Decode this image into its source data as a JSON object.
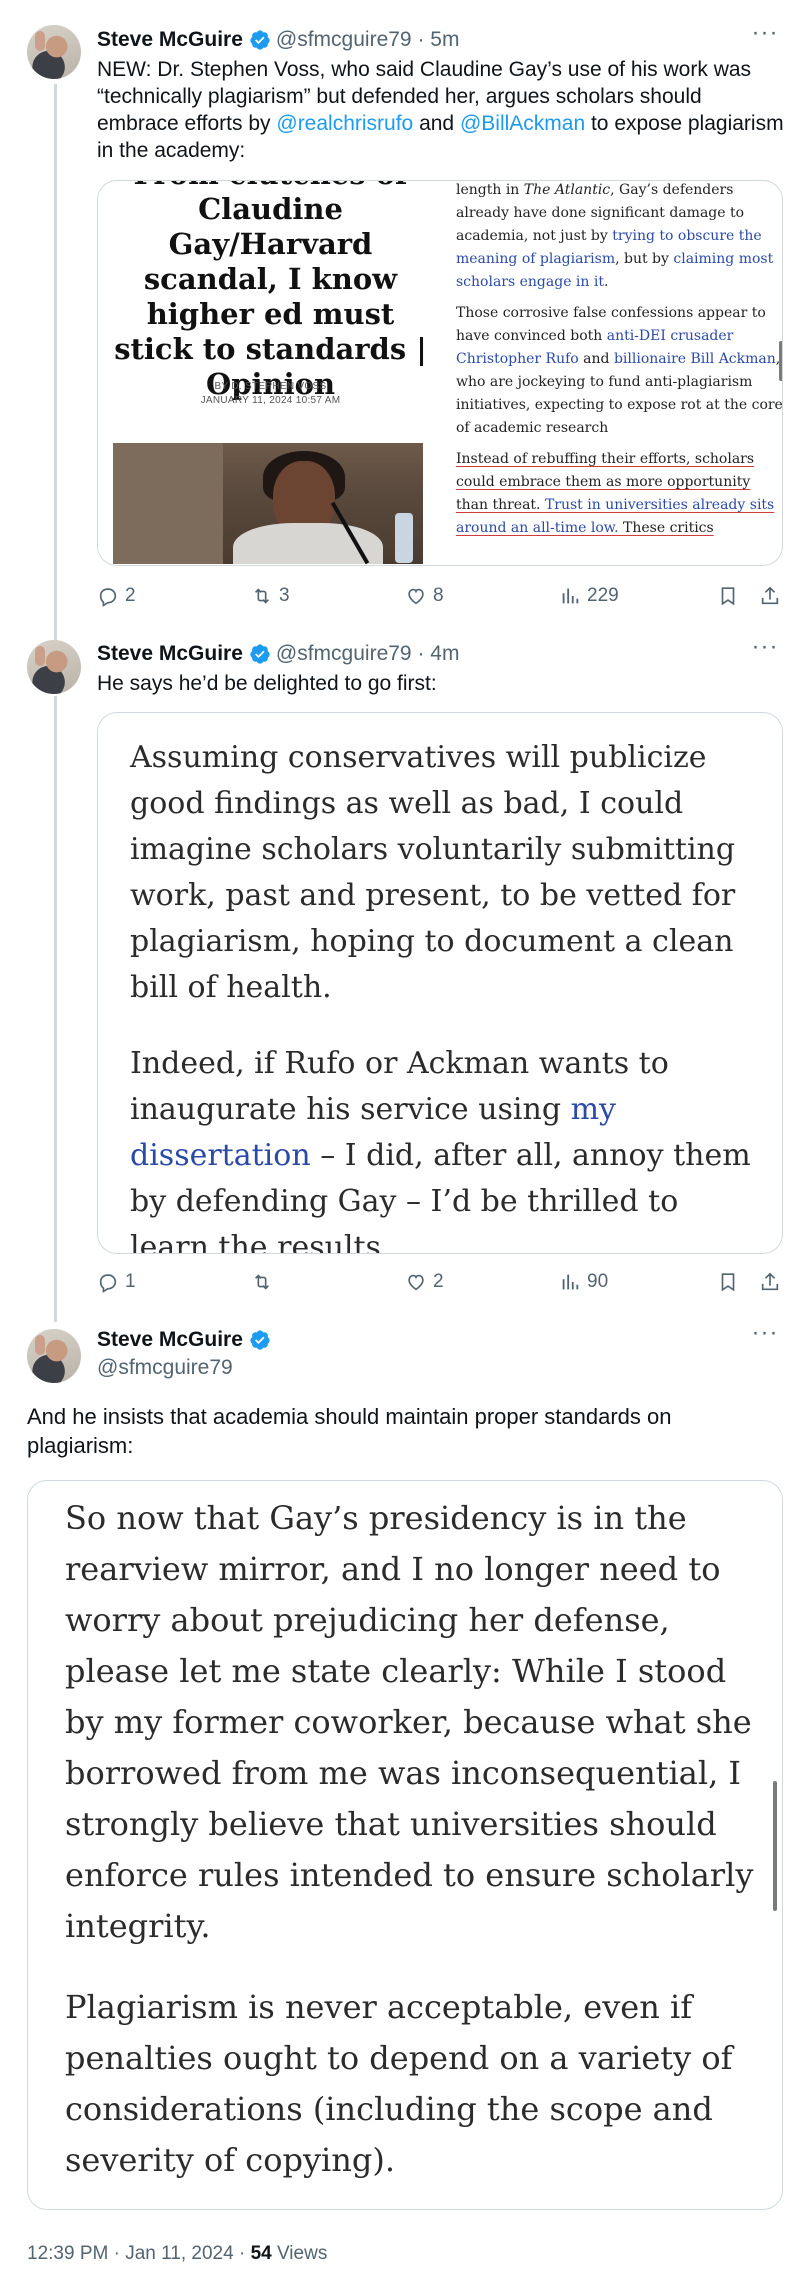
{
  "tweets": [
    {
      "name": "Steve McGuire",
      "handle": "@sfmcguire79",
      "time": "5m",
      "text_before": "NEW: Dr. Stephen Voss, who said Claudine Gay’s use of his work was “technically plagiarism” but defended her, argues scholars should embrace efforts by ",
      "mention1": "@realchrisrufo",
      "text_and": " and ",
      "mention2": "@BillAckman",
      "text_after": " to expose plagiarism in the academy:",
      "media": {
        "headline": "From clutches of Claudine Gay/Harvard scandal, I know higher ed must stick to standards | Opinion",
        "headline_visible": "Claudine Gay/Harvard scandal, I know higher ed must stick to standards | Opinion",
        "headline_cut_top": "From clutches of",
        "byline": "BY D. STEPHEN VOSS",
        "dateline": "JANUARY 11, 2024 10:57 AM",
        "p1_a": "length in ",
        "p1_atlantic": "The Atlantic",
        "p1_b": ", Gay’s defenders already have done significant damage to academia, not just by ",
        "p1_link1": "trying to obscure the meaning of plagiarism",
        "p1_c": ", but by ",
        "p1_link2": "claiming most scholars engage in it",
        "p1_d": ".",
        "p2_a": "Those corrosive false confessions appear to have convinced both ",
        "p2_link1": "anti-DEI crusader Christopher Rufo",
        "p2_b": " and ",
        "p2_link2": "billionaire Bill Ackman",
        "p2_c": ", who are jockeying to fund anti-plagiarism initiatives, expecting to expose rot at the core of academic research",
        "p3_a": "Instead of rebuffing their efforts, scholars could embrace them as more opportunity than threat. ",
        "p3_link": "Trust in universities already sits around an all-time low.",
        "p3_b": " These critics"
      },
      "stats": {
        "replies": "2",
        "reposts": "3",
        "likes": "8",
        "views": "229"
      }
    },
    {
      "name": "Steve McGuire",
      "handle": "@sfmcguire79",
      "time": "4m",
      "text": "He says he’d be delighted to go first:",
      "quote_p1": "Assuming conservatives will publicize good findings as well as bad, I could imagine scholars voluntarily submitting work, past and present, to be vetted for plagiarism, hoping to document a clean bill of health.",
      "quote_p2_a": "Indeed, if Rufo or Ackman wants to inaugurate his service using ",
      "quote_p2_link": "my dissertation",
      "quote_p2_b": " – I did, after all, annoy them by defending Gay – I’d be thrilled to learn the results.",
      "stats": {
        "replies": "1",
        "reposts": "",
        "likes": "2",
        "views": "90"
      }
    },
    {
      "name": "Steve McGuire",
      "handle": "@sfmcguire79",
      "text": "And he insists that academia should maintain proper standards on plagiarism:",
      "quote_p1": "So now that Gay’s presidency is in the rearview mirror, and I no longer need to worry about prejudicing her defense, please let me state clearly: While I stood by my former coworker, because what she borrowed from me was inconsequential, I strongly believe that universities should enforce rules intended to ensure scholarly integrity.",
      "quote_p2": "Plagiarism is never acceptable, even if penalties ought to depend on a variety of considerations (including the scope and severity of copying)."
    }
  ],
  "footer": {
    "timestamp": "12:39 PM · Jan 11, 2024 · ",
    "views_count": "54",
    "views_label": " Views"
  },
  "colors": {
    "verified": "#1d9bf0",
    "link": "#1d9bf0",
    "secondary_text": "#536471",
    "border": "#cfd9de"
  },
  "icons": [
    "verified-badge-icon",
    "more-icon",
    "reply-icon",
    "repost-icon",
    "like-icon",
    "views-icon",
    "bookmark-icon",
    "share-icon"
  ]
}
